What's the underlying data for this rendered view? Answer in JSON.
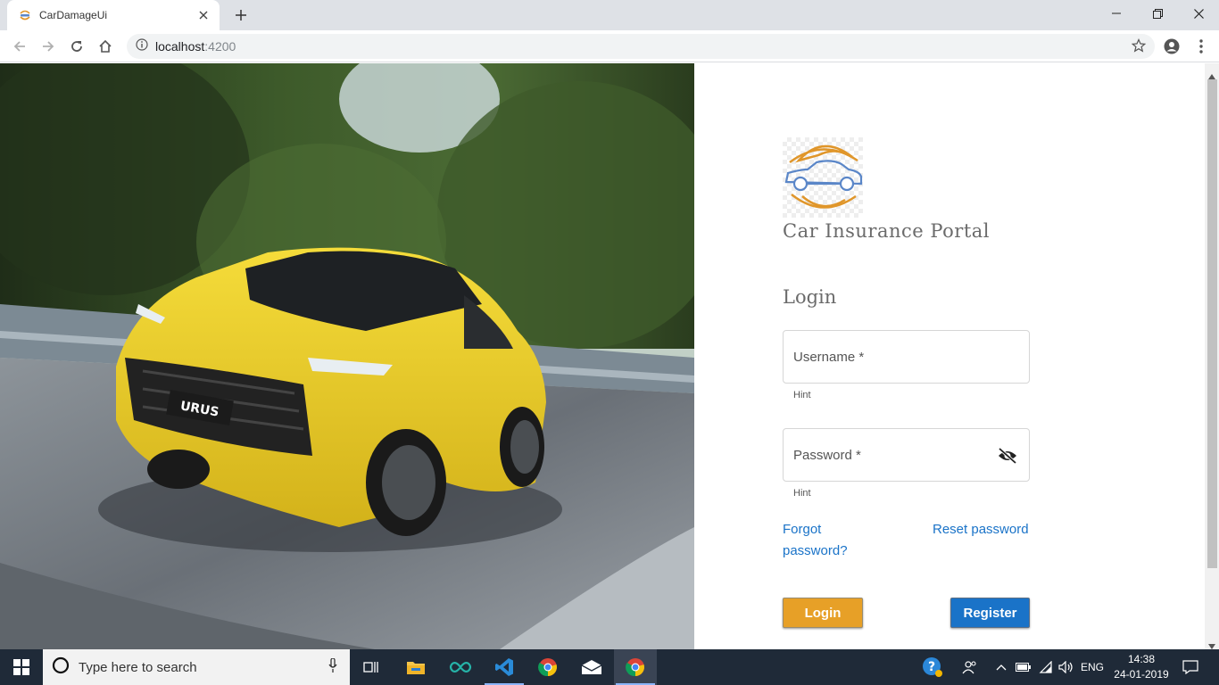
{
  "browser": {
    "tab_title": "CarDamageUi",
    "url_host": "localhost",
    "url_port": ":4200"
  },
  "page": {
    "brand_name": "Car Insurance Portal",
    "login_heading": "Login",
    "username": {
      "label": "Username *",
      "hint": "Hint",
      "value": ""
    },
    "password": {
      "label": "Password *",
      "hint": "Hint",
      "value": ""
    },
    "forgot_password_line1": "Forgot",
    "forgot_password_line2": "password?",
    "reset_password": "Reset password",
    "login_button": "Login",
    "register_button": "Register",
    "colors": {
      "login_button": "#e7a027",
      "register_button": "#1a73c8",
      "link": "#1a73c8"
    },
    "hero_plate_text": "URUS"
  },
  "taskbar": {
    "search_placeholder": "Type here to search",
    "language": "ENG",
    "time": "14:38",
    "date": "24-01-2019"
  }
}
